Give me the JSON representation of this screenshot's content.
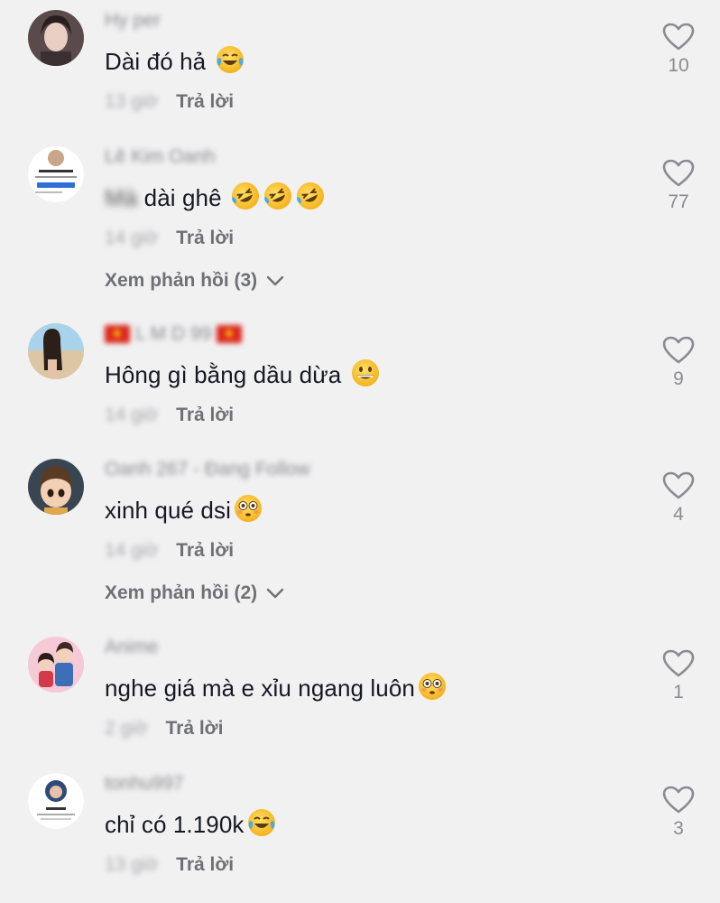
{
  "reply_label": "Trả lời",
  "comments": [
    {
      "username": "Hy per",
      "text": "Dài đó hả",
      "emojis": [
        "laugh-cry"
      ],
      "time": "13 giờ",
      "likes": "10",
      "view_replies": null
    },
    {
      "username": "Lê Kim Oanh",
      "text_blurred": "Mà",
      "text": "dài ghê",
      "emojis": [
        "rofl",
        "rofl",
        "rofl"
      ],
      "time": "14 giờ",
      "likes": "77",
      "view_replies": "Xem phản hồi (3)"
    },
    {
      "username": "L M D 99",
      "text": "Hông gì bằng dầu dừa",
      "emojis": [
        "grin"
      ],
      "time": "14 giờ",
      "likes": "9",
      "view_replies": null
    },
    {
      "username": "Oanh 267 - Đang Follow",
      "text": "xinh qué dsi",
      "emojis": [
        "flushed"
      ],
      "time": "14 giờ",
      "likes": "4",
      "view_replies": "Xem phản hồi (2)"
    },
    {
      "username": "Anime",
      "text": "nghe giá mà e xỉu ngang luôn",
      "emojis": [
        "flushed"
      ],
      "time": "2 giờ",
      "likes": "1",
      "view_replies": null
    },
    {
      "username": "tonhu997",
      "text": "chỉ có 1.190k",
      "emojis": [
        "laugh-cry"
      ],
      "time": "13 giờ",
      "likes": "3",
      "view_replies": null
    }
  ],
  "colors": {
    "background": "#f1f1f2",
    "text_primary": "#161823",
    "text_secondary": "#8a8b91",
    "reply_gray": "#6f7076",
    "emoji_yellow": "#f7c23a"
  }
}
